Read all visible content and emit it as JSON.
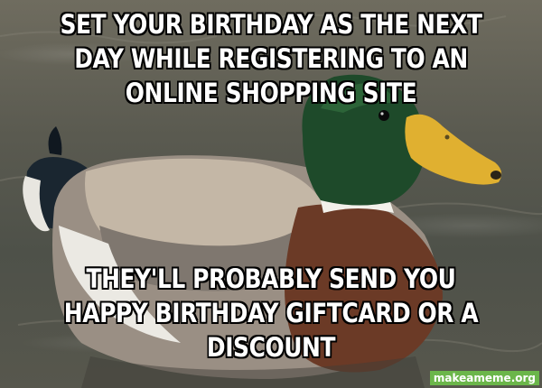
{
  "meme": {
    "top_text": "SET YOUR BIRTHDAY AS THE NEXT DAY WHILE REGISTERING TO AN ONLINE SHOPPING SITE",
    "bottom_text": "THEY'LL PROBABLY SEND YOU HAPPY BIRTHDAY GIFTCARD OR A DISCOUNT",
    "watermark": "makeameme.org"
  },
  "colors": {
    "water": "#5a5a50",
    "duck_head": "#1e4a2a",
    "duck_bill": "#e0b030",
    "duck_breast": "#6b3a26",
    "caption_text": "#ffffff",
    "watermark_bg": "#6bb64a"
  },
  "icons": {
    "subject": "mallard-duck-image"
  }
}
